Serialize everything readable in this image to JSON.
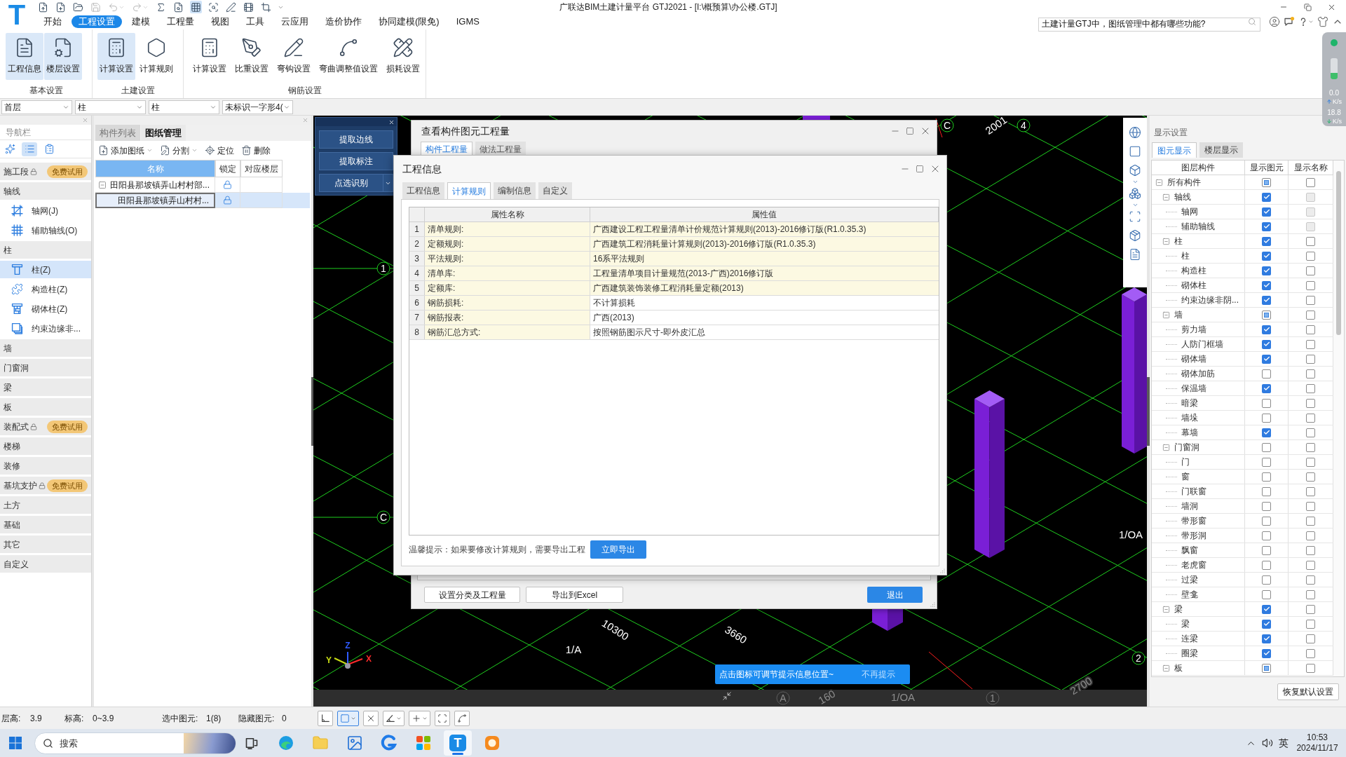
{
  "title_bar": {
    "logo": "T",
    "title": "广联达BIM土建计量平台 GTJ2021 - [I:\\概预算\\办公楼.GTJ]",
    "quick_access": [
      {
        "disabled": false,
        "selected": false,
        "dropdown": false
      },
      {
        "disabled": false,
        "selected": false,
        "dropdown": false
      },
      {
        "disabled": false,
        "selected": false,
        "dropdown": false
      },
      {
        "disabled": true,
        "selected": false,
        "dropdown": false
      },
      {
        "disabled": true,
        "selected": false,
        "dropdown": true
      },
      {
        "disabled": true,
        "selected": false,
        "dropdown": true
      },
      {
        "disabled": false,
        "selected": false,
        "dropdown": false
      },
      {
        "disabled": false,
        "selected": false,
        "dropdown": false
      },
      {
        "disabled": false,
        "selected": true,
        "dropdown": false
      },
      {
        "disabled": false,
        "selected": false,
        "dropdown": false
      },
      {
        "disabled": false,
        "selected": false,
        "dropdown": false
      },
      {
        "disabled": false,
        "selected": false,
        "dropdown": false
      },
      {
        "disabled": false,
        "selected": false,
        "dropdown": false
      }
    ]
  },
  "menu": {
    "tabs": [
      {
        "label": "开始",
        "selected": false
      },
      {
        "label": "工程设置",
        "selected": true
      },
      {
        "label": "建模",
        "selected": false
      },
      {
        "label": "工程量",
        "selected": false
      },
      {
        "label": "视图",
        "selected": false
      },
      {
        "label": "工具",
        "selected": false
      },
      {
        "label": "云应用",
        "selected": false
      },
      {
        "label": "造价协作",
        "selected": false
      },
      {
        "label": "协同建模(限免)",
        "selected": false
      },
      {
        "label": "IGMS",
        "selected": false
      }
    ],
    "help_search": {
      "value": "土建计量GTJ中，图纸管理中都有哪些功能?"
    }
  },
  "ribbon": {
    "groups": [
      {
        "label": "基本设置",
        "buttons": [
          {
            "label": "工程信息",
            "highlighted": true
          },
          {
            "label": "楼层设置",
            "highlighted": true
          }
        ]
      },
      {
        "label": "土建设置",
        "buttons": [
          {
            "label": "计算设置",
            "highlighted": true
          },
          {
            "label": "计算规则",
            "highlighted": false
          }
        ]
      },
      {
        "label": "钢筋设置",
        "buttons": [
          {
            "label": "计算设置",
            "highlighted": false
          },
          {
            "label": "比重设置",
            "highlighted": false
          },
          {
            "label": "弯钩设置",
            "highlighted": false
          },
          {
            "label": "弯曲调整值设置",
            "highlighted": false
          },
          {
            "label": "损耗设置",
            "highlighted": false
          }
        ]
      }
    ]
  },
  "filters": [
    {
      "value": "首层"
    },
    {
      "value": "柱"
    },
    {
      "value": "柱"
    },
    {
      "value": "未标识一字形4("
    }
  ],
  "nav_panel": {
    "title": "导航栏",
    "view_modes": [
      {
        "selected": false
      },
      {
        "selected": true
      },
      {
        "selected": false
      }
    ],
    "items": [
      {
        "label": "施工段",
        "locked": true,
        "badge": "免费试用"
      },
      {
        "label": "轴线",
        "locked": false,
        "children": [
          {
            "label": "轴网(J)",
            "selected": false
          },
          {
            "label": "辅助轴线(O)",
            "selected": false
          }
        ]
      },
      {
        "label": "柱",
        "locked": false,
        "children": [
          {
            "label": "柱(Z)",
            "selected": true
          },
          {
            "label": "构造柱(Z)",
            "selected": false
          },
          {
            "label": "砌体柱(Z)",
            "selected": false
          },
          {
            "label": "约束边缘非...",
            "selected": false
          }
        ]
      },
      {
        "label": "墙",
        "locked": false
      },
      {
        "label": "门窗洞",
        "locked": false
      },
      {
        "label": "梁",
        "locked": false
      },
      {
        "label": "板",
        "locked": false
      },
      {
        "label": "装配式",
        "locked": true,
        "badge": "免费试用"
      },
      {
        "label": "楼梯",
        "locked": false
      },
      {
        "label": "装修",
        "locked": false
      },
      {
        "label": "基坑支护",
        "locked": true,
        "badge": "免费试用"
      },
      {
        "label": "土方",
        "locked": false
      },
      {
        "label": "基础",
        "locked": false
      },
      {
        "label": "其它",
        "locked": false
      },
      {
        "label": "自定义",
        "locked": false
      }
    ]
  },
  "drawing_panel": {
    "tabs": [
      {
        "label": "构件列表",
        "selected": false
      },
      {
        "label": "图纸管理",
        "selected": true
      }
    ],
    "toolbar": [
      {
        "label": "添加图纸",
        "dropdown": true
      },
      {
        "label": "分割",
        "dropdown": true
      },
      {
        "label": "定位",
        "dropdown": false
      },
      {
        "label": "删除",
        "dropdown": false
      }
    ],
    "columns": [
      "名称",
      "锁定",
      "对应楼层"
    ],
    "rows": [
      {
        "name": "田阳县那坡镇弄山村村部...",
        "expanded": true,
        "selected": false,
        "children": [
          {
            "name": "田阳县那坡镇弄山村村...",
            "selected": true
          }
        ]
      }
    ]
  },
  "canvas": {
    "labels": [
      {
        "text": "C",
        "kind": "bubble",
        "dimmed": false
      },
      {
        "text": "2001",
        "kind": "text",
        "dimmed": false
      },
      {
        "text": "4",
        "kind": "bubble",
        "dimmed": false
      },
      {
        "text": "1",
        "kind": "bubble",
        "dimmed": false
      },
      {
        "text": "C",
        "kind": "bubble",
        "dimmed": false
      },
      {
        "text": "1/OA",
        "kind": "text",
        "dimmed": false
      },
      {
        "text": "1/A",
        "kind": "text",
        "dimmed": false
      },
      {
        "text": "10300",
        "kind": "text",
        "dimmed": false
      },
      {
        "text": "3660",
        "kind": "text",
        "dimmed": false
      },
      {
        "text": "2",
        "kind": "bubble",
        "dimmed": false
      },
      {
        "text": "A",
        "kind": "bubble",
        "dimmed": true
      },
      {
        "text": "160",
        "kind": "text",
        "dimmed": true
      },
      {
        "text": "1/OA",
        "kind": "text",
        "dimmed": true
      },
      {
        "text": "1",
        "kind": "bubble",
        "dimmed": true
      },
      {
        "text": "2700",
        "kind": "text",
        "dimmed": true
      }
    ],
    "axes": [
      {
        "label": "Y",
        "color": "#c8dc14"
      },
      {
        "label": "Z",
        "color": "#2f5bff"
      },
      {
        "label": "X",
        "color": "#ff2a2a"
      }
    ]
  },
  "cad_panel": {
    "buttons": [
      {
        "label": "提取边线",
        "dropdown": false
      },
      {
        "label": "提取标注",
        "dropdown": false
      },
      {
        "label": "点选识别",
        "dropdown": true
      }
    ]
  },
  "quantity_dialog": {
    "title": "查看构件图元工程量",
    "tabs": [
      {
        "label": "构件工程量",
        "selected": true
      },
      {
        "label": "做法工程量",
        "selected": false
      }
    ],
    "buttons": [
      {
        "label": "设置分类及工程量",
        "kind": "secondary"
      },
      {
        "label": "导出到Excel",
        "kind": "secondary"
      },
      {
        "label": "退出",
        "kind": "primary"
      }
    ]
  },
  "project_dialog": {
    "title": "工程信息",
    "tabs": [
      {
        "label": "工程信息",
        "selected": false
      },
      {
        "label": "计算规则",
        "selected": true
      },
      {
        "label": "编制信息",
        "selected": false
      },
      {
        "label": "自定义",
        "selected": false
      }
    ],
    "columns": [
      "属性名称",
      "属性值"
    ],
    "rows": [
      {
        "number": "1",
        "name": "清单规则:",
        "value": "广西建设工程工程量清单计价规范计算规则(2013)-2016修订版(R1.0.35.3)",
        "highlighted": true
      },
      {
        "number": "2",
        "name": "定额规则:",
        "value": "广西建筑工程消耗量计算规则(2013)-2016修订版(R1.0.35.3)",
        "highlighted": true
      },
      {
        "number": "3",
        "name": "平法规则:",
        "value": "16系平法规则",
        "highlighted": true
      },
      {
        "number": "4",
        "name": "清单库:",
        "value": "工程量清单项目计量规范(2013-广西)2016修订版",
        "highlighted": true
      },
      {
        "number": "5",
        "name": "定额库:",
        "value": "广西建筑装饰装修工程消耗量定额(2013)",
        "highlighted": true
      },
      {
        "number": "6",
        "name": "钢筋损耗:",
        "value": "不计算损耗",
        "highlighted": false
      },
      {
        "number": "7",
        "name": "钢筋报表:",
        "value": "广西(2013)",
        "highlighted": false
      },
      {
        "number": "8",
        "name": "钢筋汇总方式:",
        "value": "按照钢筋图示尺寸-即外皮汇总",
        "highlighted": false
      }
    ],
    "hint": "温馨提示：如果要修改计算规则，需要导出工程",
    "action": "立即导出"
  },
  "toast": {
    "message": "点击图标可调节提示信息位置~",
    "dismiss": "不再提示"
  },
  "display_panel": {
    "title": "显示设置",
    "tabs": [
      {
        "label": "图元显示",
        "selected": true
      },
      {
        "label": "楼层显示",
        "selected": false
      }
    ],
    "columns": [
      "图层构件",
      "显示图元",
      "显示名称"
    ],
    "tree": [
      {
        "label": "所有构件",
        "expanded": true,
        "show_element": true,
        "partial": true,
        "show_name": false,
        "name_disabled": false,
        "children": [
          {
            "label": "轴线",
            "expanded": true,
            "show_element": true,
            "partial": false,
            "show_name": false,
            "name_disabled": true,
            "children": [
              {
                "label": "轴网",
                "show_element": true,
                "partial": false,
                "show_name": false,
                "name_disabled": true
              },
              {
                "label": "辅助轴线",
                "show_element": true,
                "partial": false,
                "show_name": false,
                "name_disabled": true
              }
            ]
          },
          {
            "label": "柱",
            "expanded": true,
            "show_element": true,
            "partial": false,
            "show_name": false,
            "name_disabled": false,
            "children": [
              {
                "label": "柱",
                "show_element": true,
                "partial": false,
                "show_name": false,
                "name_disabled": false
              },
              {
                "label": "构造柱",
                "show_element": true,
                "partial": false,
                "show_name": false,
                "name_disabled": false
              },
              {
                "label": "砌体柱",
                "show_element": true,
                "partial": false,
                "show_name": false,
                "name_disabled": false
              },
              {
                "label": "约束边缘非阴...",
                "show_element": true,
                "partial": false,
                "show_name": false,
                "name_disabled": false
              }
            ]
          },
          {
            "label": "墙",
            "expanded": true,
            "show_element": true,
            "partial": true,
            "show_name": false,
            "name_disabled": false,
            "children": [
              {
                "label": "剪力墙",
                "show_element": true,
                "partial": false,
                "show_name": false,
                "name_disabled": false
              },
              {
                "label": "人防门框墙",
                "show_element": true,
                "partial": false,
                "show_name": false,
                "name_disabled": false
              },
              {
                "label": "砌体墙",
                "show_element": true,
                "partial": false,
                "show_name": false,
                "name_disabled": false
              },
              {
                "label": "砌体加筋",
                "show_element": false,
                "partial": false,
                "show_name": false,
                "name_disabled": false
              },
              {
                "label": "保温墙",
                "show_element": true,
                "partial": false,
                "show_name": false,
                "name_disabled": false
              },
              {
                "label": "暗梁",
                "show_element": false,
                "partial": false,
                "show_name": false,
                "name_disabled": false
              },
              {
                "label": "墙垛",
                "show_element": false,
                "partial": false,
                "show_name": false,
                "name_disabled": false
              },
              {
                "label": "幕墙",
                "show_element": true,
                "partial": false,
                "show_name": false,
                "name_disabled": false
              }
            ]
          },
          {
            "label": "门窗洞",
            "expanded": true,
            "show_element": false,
            "partial": false,
            "show_name": false,
            "name_disabled": false,
            "children": [
              {
                "label": "门",
                "show_element": false,
                "partial": false,
                "show_name": false,
                "name_disabled": false
              },
              {
                "label": "窗",
                "show_element": false,
                "partial": false,
                "show_name": false,
                "name_disabled": false
              },
              {
                "label": "门联窗",
                "show_element": false,
                "partial": false,
                "show_name": false,
                "name_disabled": false
              },
              {
                "label": "墙洞",
                "show_element": false,
                "partial": false,
                "show_name": false,
                "name_disabled": false
              },
              {
                "label": "带形窗",
                "show_element": false,
                "partial": false,
                "show_name": false,
                "name_disabled": false
              },
              {
                "label": "带形洞",
                "show_element": false,
                "partial": false,
                "show_name": false,
                "name_disabled": false
              },
              {
                "label": "飘窗",
                "show_element": false,
                "partial": false,
                "show_name": false,
                "name_disabled": false
              },
              {
                "label": "老虎窗",
                "show_element": false,
                "partial": false,
                "show_name": false,
                "name_disabled": false
              },
              {
                "label": "过梁",
                "show_element": false,
                "partial": false,
                "show_name": false,
                "name_disabled": false
              },
              {
                "label": "壁龛",
                "show_element": false,
                "partial": false,
                "show_name": false,
                "name_disabled": false
              }
            ]
          },
          {
            "label": "梁",
            "expanded": true,
            "show_element": true,
            "partial": false,
            "show_name": false,
            "name_disabled": false,
            "children": [
              {
                "label": "梁",
                "show_element": true,
                "partial": false,
                "show_name": false,
                "name_disabled": false
              },
              {
                "label": "连梁",
                "show_element": true,
                "partial": false,
                "show_name": false,
                "name_disabled": false
              },
              {
                "label": "圈梁",
                "show_element": true,
                "partial": false,
                "show_name": false,
                "name_disabled": false
              }
            ]
          },
          {
            "label": "板",
            "expanded": true,
            "show_element": true,
            "partial": true,
            "show_name": false,
            "name_disabled": false
          }
        ]
      }
    ],
    "reset_button": "恢复默认设置"
  },
  "status_bar": {
    "fields": [
      {
        "label": "层高:",
        "value": "3.9"
      },
      {
        "label": "标高:",
        "value": "0~3.9"
      },
      {
        "label": "选中图元:",
        "value": "1(8)"
      },
      {
        "label": "隐藏图元:",
        "value": "0"
      }
    ],
    "tools": [
      {
        "selected": false,
        "dropdown": false
      },
      {
        "selected": true,
        "dropdown": true
      },
      {
        "selected": false,
        "dropdown": false
      },
      {
        "selected": false,
        "dropdown": true
      },
      {
        "selected": false,
        "dropdown": true
      },
      {
        "selected": false,
        "dropdown": false
      },
      {
        "selected": false,
        "dropdown": false
      }
    ]
  },
  "net_monitor": {
    "upload": "0.0",
    "upload_unit": "K/s",
    "download": "18.8",
    "download_unit": "K/s",
    "level": 0.3
  },
  "taskbar": {
    "search": {
      "placeholder": "搜索"
    },
    "apps": [
      {
        "active": false
      },
      {
        "active": false
      },
      {
        "active": false
      },
      {
        "active": false
      },
      {
        "active": false
      },
      {
        "active": false
      },
      {
        "active": true,
        "letter": "T"
      },
      {
        "active": false
      }
    ],
    "ime": "英",
    "time": "10:53",
    "date": "2024/11/17"
  }
}
